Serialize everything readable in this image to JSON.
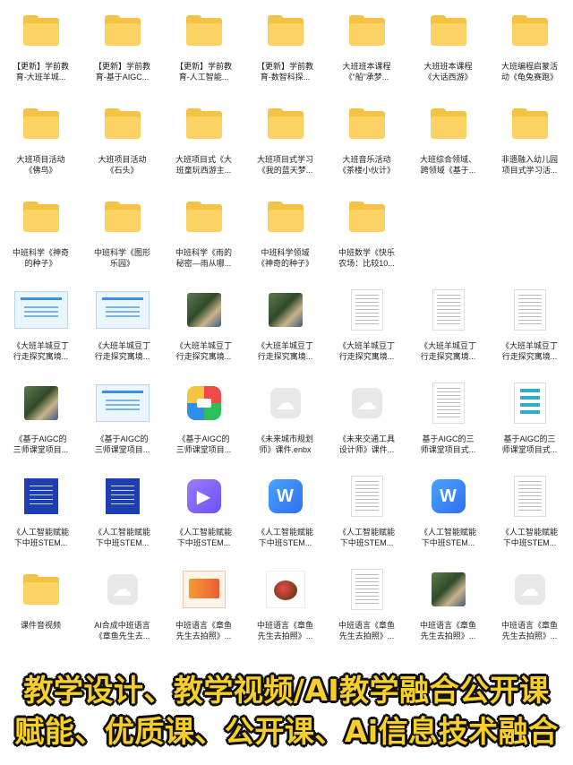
{
  "files": [
    {
      "label": "【更新】学前教\n育-大班羊城...",
      "icon": "folder-icon"
    },
    {
      "label": "【更新】学前教\n育-基于AIGC...",
      "icon": "folder-icon"
    },
    {
      "label": "【更新】学前教\n育-人工智能...",
      "icon": "folder-icon"
    },
    {
      "label": "【更新】学前教\n育-数智科探...",
      "icon": "folder-icon"
    },
    {
      "label": "大班班本课程\n《“船”承梦...",
      "icon": "folder-icon"
    },
    {
      "label": "大班班本课程\n《大话西游》",
      "icon": "folder-icon"
    },
    {
      "label": "大班编程启蒙活\n动《龟兔赛跑》",
      "icon": "folder-icon"
    },
    {
      "label": "大班项目活动\n《佛鸟》",
      "icon": "folder-icon"
    },
    {
      "label": "大班项目活动\n《石头》",
      "icon": "folder-icon"
    },
    {
      "label": "大班项目式《大\n班童玩西游主...",
      "icon": "folder-icon"
    },
    {
      "label": "大班项目式学习\n《我的蓝天梦...",
      "icon": "folder-icon"
    },
    {
      "label": "大班音乐活动\n《茶楼小伙计》",
      "icon": "folder-icon"
    },
    {
      "label": "大班综合领域、\n跨领域《基于...",
      "icon": "folder-icon"
    },
    {
      "label": "非遗融入幼儿园\n项目式学习活...",
      "icon": "folder-icon"
    },
    {
      "label": "中班科学《神奇\n的种子》",
      "icon": "folder-icon"
    },
    {
      "label": "中班科学《图形\n乐园》",
      "icon": "folder-icon"
    },
    {
      "label": "中班科学《雨的\n秘密—雨从哪...",
      "icon": "folder-icon"
    },
    {
      "label": "中班科学领域\n《神奇的种子》",
      "icon": "folder-icon"
    },
    {
      "label": "中班数学《快乐\n农场：比较10...",
      "icon": "folder-icon"
    },
    {
      "label": "《大班羊城豆丁\n行走探究寓境...",
      "icon": "slide-thumb"
    },
    {
      "label": "《大班羊城豆丁\n行走探究寓境...",
      "icon": "slide-thumb"
    },
    {
      "label": "《大班羊城豆丁\n行走探究寓境...",
      "icon": "photo-thumb"
    },
    {
      "label": "《大班羊城豆丁\n行走探究寓境...",
      "icon": "photo-thumb"
    },
    {
      "label": "《大班羊城豆丁\n行走探究寓境...",
      "icon": "paper-thumb"
    },
    {
      "label": "《大班羊城豆丁\n行走探究寓境...",
      "icon": "paper-thumb"
    },
    {
      "label": "《大班羊城豆丁\n行走探究寓境...",
      "icon": "paper-thumb"
    },
    {
      "label": "《基于AIGC的\n三师课堂项目...",
      "icon": "photo-thumb"
    },
    {
      "label": "《基于AIGC的\n三师课堂项目...",
      "icon": "slide-thumb"
    },
    {
      "label": "《基于AIGC的\n三师课堂项目...",
      "icon": "archive-icon"
    },
    {
      "label": "《未来城市规划\n师》课件.enbx",
      "icon": "cloud-icon"
    },
    {
      "label": "《未来交通工具\n设计师》课件...",
      "icon": "cloud-icon"
    },
    {
      "label": "基于AIGC的三\n师课堂项目式...",
      "icon": "paper-thumb"
    },
    {
      "label": "基于AIGC的三\n师课堂项目式...",
      "icon": "infographic-thumb"
    },
    {
      "label": "《人工智能赋能\n下中班STEM...",
      "icon": "blue-doc-thumb"
    },
    {
      "label": "《人工智能赋能\n下中班STEM...",
      "icon": "blue-doc-thumb"
    },
    {
      "label": "《人工智能赋能\n下中班STEM...",
      "icon": "video-icon"
    },
    {
      "label": "《人工智能赋能\n下中班STEM...",
      "icon": "word-icon"
    },
    {
      "label": "《人工智能赋能\n下中班STEM...",
      "icon": "paper-thumb"
    },
    {
      "label": "《人工智能赋能\n下中班STEM...",
      "icon": "word-icon"
    },
    {
      "label": "《人工智能赋能\n下中班STEM...",
      "icon": "paper-thumb"
    },
    {
      "label": "课件音视频",
      "icon": "folder-icon"
    },
    {
      "label": "AI合成中班语言\n《章鱼先生去...",
      "icon": "cloud-icon"
    },
    {
      "label": "中班语言《章鱼\n先生去拍照》...",
      "icon": "warm-slide-thumb"
    },
    {
      "label": "中班语言《章鱼\n先生去拍照》...",
      "icon": "cartoon-thumb"
    },
    {
      "label": "中班语言《章鱼\n先生去拍照》...",
      "icon": "paper-thumb"
    },
    {
      "label": "中班语言《章鱼\n先生去拍照》...",
      "icon": "photo-thumb"
    },
    {
      "label": "中班语言《章鱼\n先生去拍照》...",
      "icon": "cloud-icon"
    }
  ],
  "rows": [
    7,
    7,
    5,
    7,
    7,
    7,
    7
  ],
  "banner": {
    "line1": "教学设计、教学视频/AI教学融合公开课",
    "line2": "赋能、优质课、公开课、Ai信息技术融合"
  },
  "colors": {
    "folder": "#f5c243",
    "banner_text": "#f6cf28",
    "banner_outline": "#111111"
  }
}
